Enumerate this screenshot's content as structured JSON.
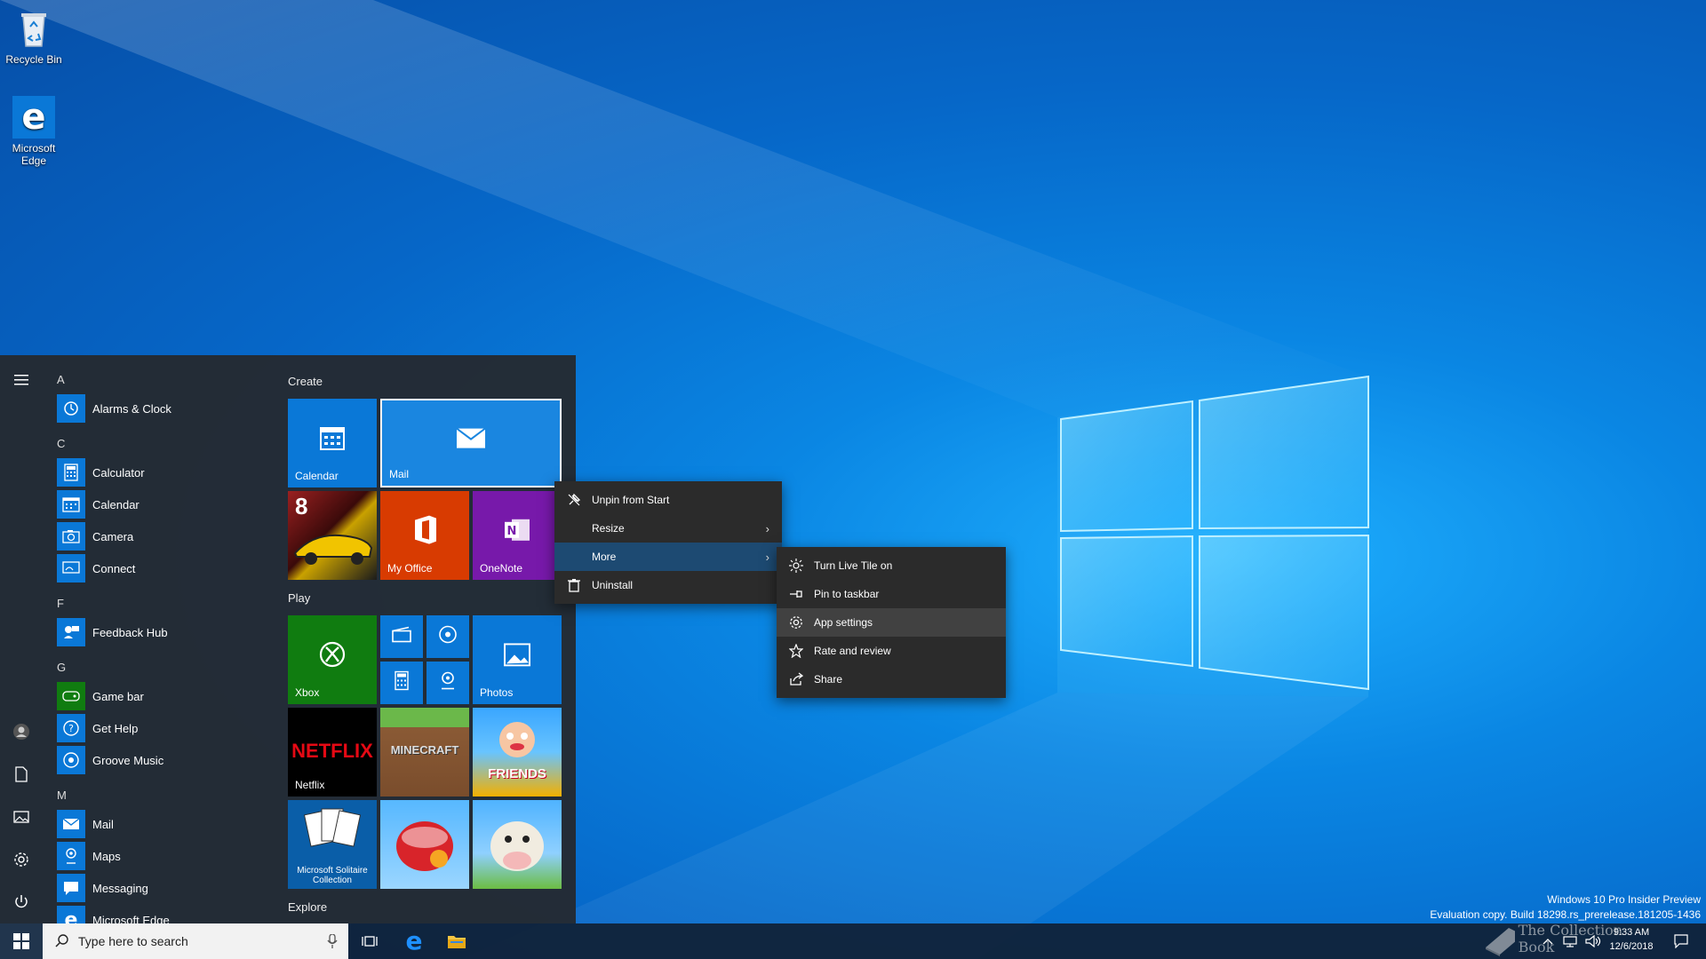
{
  "desktop": {
    "icons": [
      {
        "label": "Recycle Bin"
      },
      {
        "label": "Microsoft Edge"
      }
    ],
    "watermark": {
      "line1": "Windows 10 Pro Insider Preview",
      "line2": "Evaluation copy. Build 18298.rs_prerelease.181205-1436"
    },
    "overlay_logo_text": "The Collection Book"
  },
  "start_menu": {
    "app_list": [
      {
        "letter": "A"
      },
      {
        "app": "Alarms & Clock"
      },
      {
        "letter": "C"
      },
      {
        "app": "Calculator"
      },
      {
        "app": "Calendar"
      },
      {
        "app": "Camera"
      },
      {
        "app": "Connect"
      },
      {
        "letter": "F"
      },
      {
        "app": "Feedback Hub"
      },
      {
        "letter": "G"
      },
      {
        "app": "Game bar"
      },
      {
        "app": "Get Help"
      },
      {
        "app": "Groove Music"
      },
      {
        "letter": "M"
      },
      {
        "app": "Mail"
      },
      {
        "app": "Maps"
      },
      {
        "app": "Messaging"
      },
      {
        "app": "Microsoft Edge"
      }
    ],
    "groups": {
      "create": "Create",
      "play": "Play",
      "explore": "Explore"
    },
    "tiles": {
      "calendar": "Calendar",
      "mail": "Mail",
      "my_office": "My Office",
      "onenote": "OneNote",
      "xbox": "Xbox",
      "photos": "Photos",
      "netflix": "Netflix",
      "netflix_logo": "NETFLIX",
      "minecraft_logo": "MINECRAFT",
      "friends_logo": "FRIENDS",
      "solitaire": "Microsoft Solitaire Collection",
      "asphalt_badge": "8"
    }
  },
  "context_menu": {
    "items": [
      {
        "label": "Unpin from Start",
        "icon": "unpin-icon"
      },
      {
        "label": "Resize",
        "icon": "",
        "submenu": true
      },
      {
        "label": "More",
        "icon": "",
        "submenu": true,
        "active": true
      },
      {
        "label": "Uninstall",
        "icon": "trash-icon"
      }
    ]
  },
  "submenu": {
    "items": [
      {
        "label": "Turn Live Tile on",
        "icon": "live-tile-icon"
      },
      {
        "label": "Pin to taskbar",
        "icon": "pin-icon"
      },
      {
        "label": "App settings",
        "icon": "gear-icon",
        "hover": true
      },
      {
        "label": "Rate and review",
        "icon": "star-icon"
      },
      {
        "label": "Share",
        "icon": "share-icon"
      }
    ]
  },
  "taskbar": {
    "search_placeholder": "Type here to search",
    "time": "9:33 AM",
    "date": "12/6/2018"
  },
  "colors": {
    "tile_blue": "#0a78d7",
    "office_orange": "#d83b01",
    "onenote_purple": "#7719aa",
    "xbox_green": "#107c10",
    "context_active": "#1d4a72"
  }
}
